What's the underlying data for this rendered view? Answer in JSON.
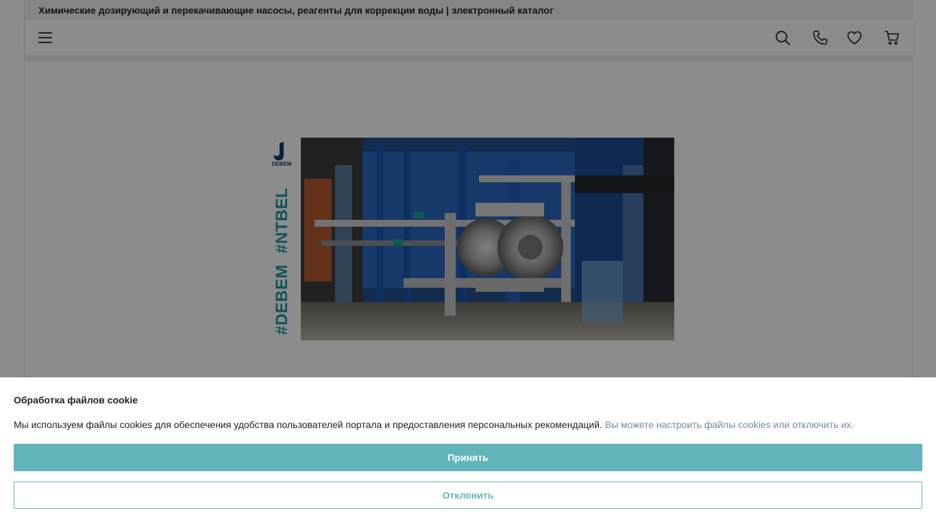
{
  "header": {
    "title": "Химические дозирующий и перекачивающие насосы, реагенты для коррекции воды | электронный каталог"
  },
  "navbar": {
    "icons": [
      "menu-icon",
      "search-icon",
      "phone-icon",
      "heart-icon",
      "cart-icon"
    ]
  },
  "banner": {
    "logo_text": "DEBEM",
    "hashtags": [
      "#DEBEM",
      "#NTBEL"
    ],
    "accent_color": "#1a9a9e"
  },
  "cookie": {
    "title": "Обработка файлов cookie",
    "text": "Мы используем файлы cookies для обеспечения удобства пользователей портала и предоставления персональных рекомендаций.",
    "link": "Вы можете настроить файлы cookies или отключить их.",
    "accept_label": "Принять",
    "decline_label": "Отклонить",
    "accent_color": "#62b4ba"
  }
}
